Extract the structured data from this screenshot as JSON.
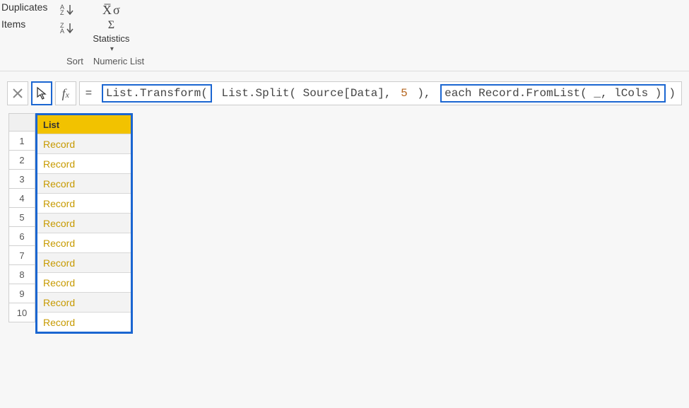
{
  "ribbon": {
    "partial_top": "Duplicates",
    "partial_bottom": "Items",
    "sort_asc": "A→Z↓",
    "sort_desc": "Z→A↓",
    "stats_label": "Statistics",
    "section_sort": "Sort",
    "section_numlist": "Numeric List"
  },
  "formula_bar": {
    "equals": "= ",
    "part1": "List.Transform(",
    "middle": " List.Split( Source[Data], ",
    "num": "5",
    "middle2": " ), ",
    "part2": "each Record.FromList( _, lCols )",
    "close": ")"
  },
  "grid": {
    "column_header": "List",
    "rows": [
      {
        "n": "1",
        "v": "Record"
      },
      {
        "n": "2",
        "v": "Record"
      },
      {
        "n": "3",
        "v": "Record"
      },
      {
        "n": "4",
        "v": "Record"
      },
      {
        "n": "5",
        "v": "Record"
      },
      {
        "n": "6",
        "v": "Record"
      },
      {
        "n": "7",
        "v": "Record"
      },
      {
        "n": "8",
        "v": "Record"
      },
      {
        "n": "9",
        "v": "Record"
      },
      {
        "n": "10",
        "v": "Record"
      }
    ]
  }
}
